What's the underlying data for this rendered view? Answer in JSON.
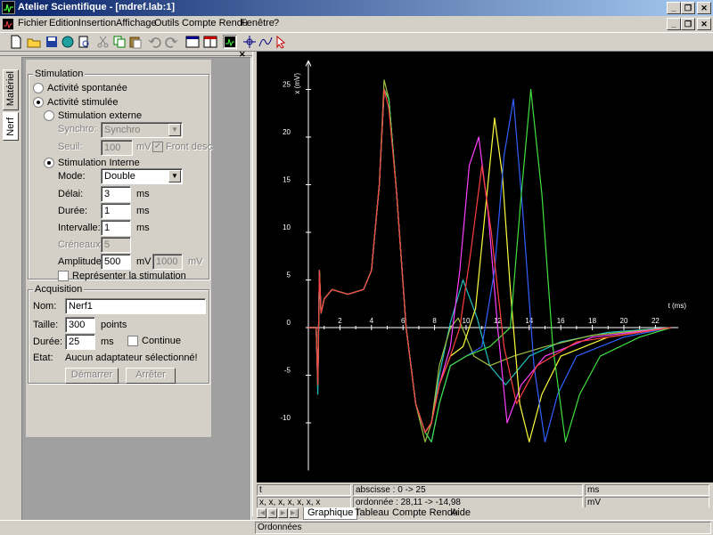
{
  "window": {
    "title": "Atelier Scientifique - [mdref.lab:1]",
    "controls": [
      "minimize",
      "restore",
      "close"
    ]
  },
  "menu": [
    "Fichier",
    "Edition",
    "Insertion",
    "Affichage",
    "Outils",
    "Compte Rendu",
    "Fenêtre",
    "?"
  ],
  "side_tabs": [
    "Matériel",
    "Nerf"
  ],
  "stimulation": {
    "legend": "Stimulation",
    "spontaneous": "Activité spontanée",
    "stimulated": "Activité stimulée",
    "external": "Stimulation externe",
    "synchro_label": "Synchro:",
    "synchro_value": "Synchro",
    "seuil_label": "Seuil:",
    "seuil_value": "100",
    "seuil_unit": "mV",
    "front_label": "Front desc",
    "internal": "Stimulation Interne",
    "mode_label": "Mode:",
    "mode_value": "Double",
    "delai_label": "Délai:",
    "delai_value": "3",
    "delai_unit": "ms",
    "duree_label": "Durée:",
    "duree_value": "1",
    "duree_unit": "ms",
    "intervalle_label": "Intervalle:",
    "intervalle_value": "1",
    "intervalle_unit": "ms",
    "creneaux_label": "Créneaux:",
    "creneaux_value": "5",
    "amplitude_label": "Amplitude:",
    "amplitude_value": "500",
    "amplitude_unit": "mV",
    "amplitude2_value": "1000",
    "amplitude2_unit": "mV",
    "represent_label": "Représenter la stimulation"
  },
  "acquisition": {
    "legend": "Acquisition",
    "nom_label": "Nom:",
    "nom_value": "Nerf1",
    "taille_label": "Taille:",
    "taille_value": "300",
    "taille_unit": "points",
    "duree_label": "Durée:",
    "duree_value": "25",
    "duree_unit": "ms",
    "continue_label": "Continue",
    "etat_label": "Etat:",
    "etat_value": "Aucun adaptateur sélectionné!",
    "start_button": "Démarrer",
    "stop_button": "Arrêter"
  },
  "status": {
    "row1_left": "t",
    "row1_mid": "abscisse : 0 -> 25",
    "row1_right": "ms",
    "row2_left": "x, x, x, x, x, x, x",
    "row2_mid": "ordonnée : 28,11 -> -14,98",
    "row2_right": "mV",
    "bottom": "Ordonnées"
  },
  "bottom_tabs": [
    "Graphique",
    "Tableau",
    "Compte Rendu",
    "Aide"
  ],
  "chart_data": {
    "type": "line",
    "xlabel": "t (ms)",
    "ylabel": "x (mV)",
    "xlim": [
      0,
      23
    ],
    "ylim": [
      -15,
      28
    ],
    "x_ticks": [
      2,
      4,
      6,
      8,
      10,
      12,
      14,
      16,
      18,
      20,
      22
    ],
    "y_ticks": [
      25,
      20,
      15,
      10,
      5,
      0,
      -5,
      -10
    ],
    "series": [
      {
        "color": "#20c0c0",
        "x": [
          0,
          0.5,
          0.6,
          0.7,
          0.8,
          1.0,
          1.5,
          2.5,
          3.5,
          4.0,
          4.5,
          4.8,
          5.1,
          5.6,
          6.2,
          6.8,
          7.4,
          7.8,
          8.3,
          9.0,
          9.8,
          10.7,
          11.5,
          12.5,
          14,
          16,
          19,
          23
        ],
        "y": [
          0,
          0,
          -7,
          5,
          1.5,
          3,
          4,
          3.5,
          4,
          6,
          15,
          25,
          24,
          14,
          0,
          -8,
          -11,
          -10,
          -5,
          0.5,
          5,
          1,
          -4,
          -6,
          -3,
          -1.5,
          -0.5,
          0
        ]
      },
      {
        "color": "#a0c040",
        "x": [
          0,
          0.5,
          0.6,
          0.7,
          0.8,
          1.0,
          1.5,
          2.5,
          3.5,
          4.0,
          4.5,
          4.8,
          5.1,
          5.6,
          6.2,
          6.8,
          7.4,
          7.8,
          8.3,
          9.0,
          9.5,
          10.5,
          11.5,
          13,
          15,
          18,
          23
        ],
        "y": [
          0,
          0,
          -6,
          6,
          1.5,
          3,
          4,
          3.5,
          4,
          6,
          15,
          26,
          24,
          14,
          0,
          -8,
          -12,
          -10,
          -4,
          0,
          1,
          -3,
          -4,
          -3,
          -2,
          -0.8,
          0
        ]
      },
      {
        "color": "#ff40ff",
        "x": [
          0,
          0.5,
          0.6,
          0.7,
          0.8,
          1.0,
          1.5,
          2.5,
          3.5,
          4.0,
          4.5,
          4.8,
          5.1,
          5.6,
          6.2,
          6.8,
          7.4,
          7.8,
          8.3,
          9.0,
          9.6,
          10.2,
          10.8,
          11.4,
          12.0,
          12.6,
          13.5,
          15,
          18,
          23
        ],
        "y": [
          0,
          0,
          -6,
          6,
          1.5,
          3,
          4,
          3.5,
          4,
          6,
          15,
          25,
          24,
          14,
          0,
          -8,
          -11,
          -10,
          -6,
          -2,
          6,
          17,
          20,
          12,
          0,
          -10,
          -6,
          -3,
          -1,
          0
        ]
      },
      {
        "color": "#ffff40",
        "x": [
          0,
          0.5,
          0.6,
          0.7,
          0.8,
          1.0,
          1.5,
          2.5,
          3.5,
          4.0,
          4.5,
          4.8,
          5.1,
          5.6,
          6.2,
          6.8,
          7.4,
          7.8,
          8.3,
          9.0,
          9.8,
          10.6,
          11.2,
          11.8,
          12.3,
          12.8,
          13.4,
          14.0,
          14.8,
          16,
          19,
          23
        ],
        "y": [
          0,
          0,
          -6,
          6,
          1.5,
          3,
          4,
          3.5,
          4,
          6,
          15,
          25,
          24,
          14,
          0,
          -8,
          -11,
          -10,
          -6,
          -3,
          -2,
          2,
          12,
          22,
          16,
          4,
          -8,
          -12,
          -7,
          -3,
          -1,
          0
        ]
      },
      {
        "color": "#3060ff",
        "x": [
          0,
          0.5,
          0.6,
          0.7,
          0.8,
          1.0,
          1.5,
          2.5,
          3.5,
          4.0,
          4.5,
          4.8,
          5.1,
          5.6,
          6.2,
          6.8,
          7.4,
          7.8,
          8.3,
          9.0,
          10,
          11,
          11.8,
          12.4,
          13.0,
          13.6,
          14.3,
          15.0,
          15.8,
          17,
          20,
          23
        ],
        "y": [
          0,
          0,
          -6,
          6,
          1.5,
          3,
          4,
          3.5,
          4,
          6,
          15,
          25,
          24,
          14,
          0,
          -8,
          -11,
          -12,
          -8,
          -4,
          -3,
          -2,
          6,
          18,
          24,
          12,
          -4,
          -12,
          -7,
          -3,
          -1,
          0
        ]
      },
      {
        "color": "#40e040",
        "x": [
          0,
          0.5,
          0.6,
          0.7,
          0.8,
          1.0,
          1.5,
          2.5,
          3.5,
          4.0,
          4.5,
          4.8,
          5.1,
          5.6,
          6.2,
          6.8,
          7.4,
          7.8,
          8.3,
          9.0,
          10,
          11.5,
          12.8,
          13.5,
          14.1,
          14.8,
          15.5,
          16.3,
          17.2,
          18.5,
          21,
          23
        ],
        "y": [
          0,
          0,
          -6,
          6,
          1.5,
          3,
          4,
          3.5,
          4,
          6,
          15,
          25,
          24,
          14,
          0,
          -8,
          -11,
          -12,
          -8,
          -4,
          -3,
          -2,
          0,
          14,
          25,
          14,
          -2,
          -12,
          -7,
          -3,
          -1,
          0
        ]
      },
      {
        "color": "#ff4040",
        "x": [
          0,
          0.5,
          0.6,
          0.7,
          0.8,
          1.0,
          1.5,
          2.5,
          3.5,
          4.0,
          4.5,
          4.8,
          5.1,
          5.6,
          6.2,
          6.8,
          7.4,
          7.8,
          8.3,
          9.0,
          9.6,
          10.3,
          11.0,
          11.6,
          12.4,
          13.2,
          14.5,
          17,
          23
        ],
        "y": [
          0,
          0,
          -6,
          6,
          1.5,
          3,
          4,
          3.5,
          4,
          6,
          15,
          25,
          23,
          14,
          0,
          -8,
          -11,
          -10,
          -6,
          -3,
          0,
          8,
          17,
          10,
          -2,
          -8,
          -4,
          -1.5,
          0
        ]
      }
    ]
  }
}
